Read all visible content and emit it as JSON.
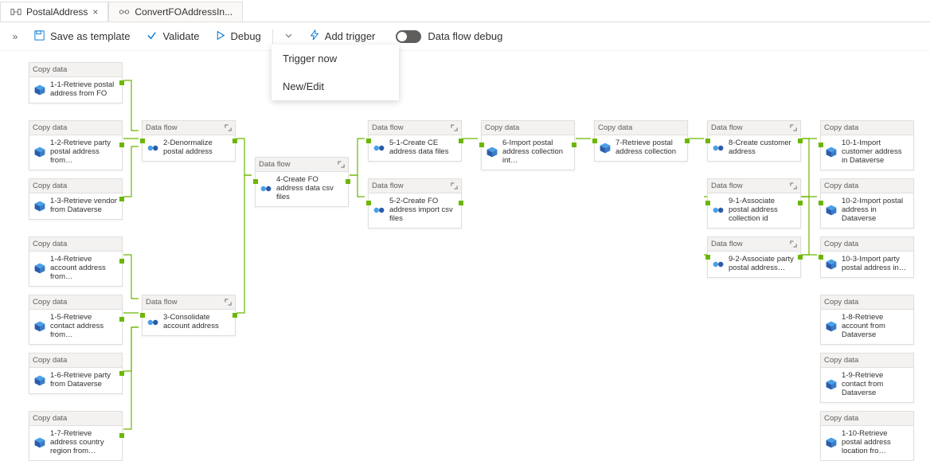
{
  "tabs": {
    "t1": "PostalAddress",
    "t2": "ConvertFOAddressIn..."
  },
  "toolbar": {
    "save": "Save as template",
    "validate": "Validate",
    "debug": "Debug",
    "addTrigger": "Add trigger",
    "dfDebug": "Data flow debug"
  },
  "menu": {
    "triggerNow": "Trigger now",
    "newEdit": "New/Edit"
  },
  "nodeTypes": {
    "copy": "Copy data",
    "flow": "Data flow"
  },
  "nodes": {
    "n11": "1-1-Retrieve postal address from FO",
    "n12": "1-2-Retrieve party postal address from…",
    "n13": "1-3-Retrieve vendor from Dataverse",
    "n14": "1-4-Retrieve account address from…",
    "n15": "1-5-Retrieve contact address from…",
    "n16": "1-6-Retrieve party from Dataverse",
    "n17": "1-7-Retrieve address country region from…",
    "n2": "2-Denormalize postal address",
    "n3": "3-Consolidate account address",
    "n4": "4-Create FO address data csv files",
    "n51": "5-1-Create CE address data files",
    "n52": "5-2-Create FO address import csv files",
    "n6": "6-Import postal address collection int…",
    "n7": "7-Retrieve postal address collection",
    "n8": "8-Create customer address",
    "n91": "9-1-Associate postal address collection id",
    "n92": "9-2-Associate party postal address…",
    "n101": "10-1-Import customer address in Dataverse",
    "n102": "10-2-Import postal address in Dataverse",
    "n103": "10-3-Import party postal address in…",
    "n18": "1-8-Retrieve account from Dataverse",
    "n19": "1-9-Retrieve contact from Dataverse",
    "n110": "1-10-Retrieve postal address location fro…"
  }
}
